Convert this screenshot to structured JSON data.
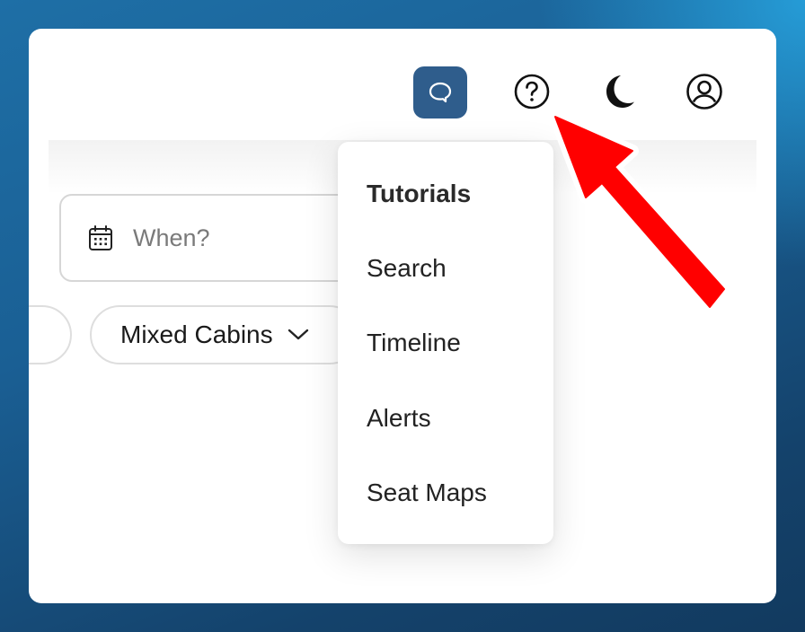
{
  "header": {
    "icons": [
      "chat-icon",
      "help-icon",
      "dark-mode-icon",
      "account-icon"
    ]
  },
  "search": {
    "date_placeholder": "When?",
    "cabin_label": "Mixed Cabins"
  },
  "tutorials_menu": {
    "title": "Tutorials",
    "items": [
      "Search",
      "Timeline",
      "Alerts",
      "Seat Maps"
    ]
  },
  "annotation": {
    "arrow_color": "#ff0000"
  },
  "colors": {
    "chat_button": "#2f5d8c",
    "background": "#1a5f94"
  }
}
